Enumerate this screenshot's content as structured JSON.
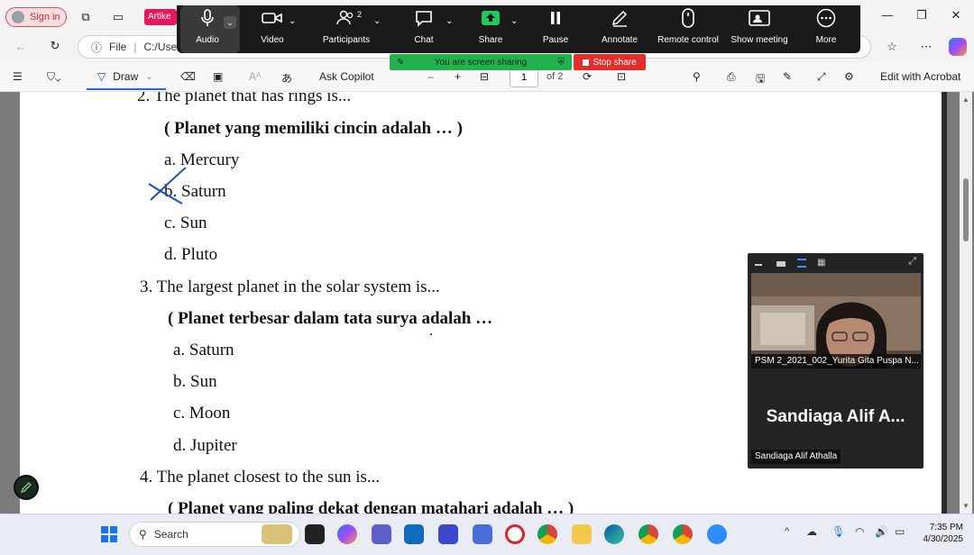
{
  "browser": {
    "sign_in": "Sign in",
    "tab_label": "Artike",
    "address_info": "File",
    "address_path": "C:/Use"
  },
  "zoom": {
    "participant_count": "2",
    "items": [
      {
        "label": "Audio",
        "icon": "microphone-icon"
      },
      {
        "label": "Video",
        "icon": "video-camera-icon"
      },
      {
        "label": "Participants",
        "icon": "participants-icon"
      },
      {
        "label": "Chat",
        "icon": "chat-icon"
      },
      {
        "label": "Share",
        "icon": "share-screen-icon"
      },
      {
        "label": "Pause",
        "icon": "pause-icon"
      },
      {
        "label": "Annotate",
        "icon": "pen-icon"
      },
      {
        "label": "Remote control",
        "icon": "mouse-icon"
      },
      {
        "label": "Show meeting",
        "icon": "meeting-window-icon"
      },
      {
        "label": "More",
        "icon": "more-icon"
      }
    ],
    "sharing_banner": "You are screen sharing",
    "stop_share": "Stop share"
  },
  "pdf_toolbar": {
    "draw": "Draw",
    "ask_copilot": "Ask Copilot",
    "page_current": "1",
    "page_total": "of 2",
    "zoom_minus": "–",
    "zoom_plus": "+",
    "edit_acrobat": "Edit with Acrobat"
  },
  "document": {
    "lines": [
      {
        "text": "2.   The planet that has rings is...",
        "bold": false
      },
      {
        "text": "( Planet yang memiliki cincin adalah … )",
        "bold": true
      },
      {
        "text": "a.   Mercury",
        "bold": false
      },
      {
        "text": "b.   Saturn",
        "bold": false
      },
      {
        "text": "c.   Sun",
        "bold": false
      },
      {
        "text": "d.   Pluto",
        "bold": false
      },
      {
        "text": "3.   The largest planet in the solar system is...",
        "bold": false
      },
      {
        "text": "( Planet terbesar dalam tata surya adalah …",
        "bold": true
      },
      {
        "text": "a.   Saturn",
        "bold": false
      },
      {
        "text": "b.   Sun",
        "bold": false
      },
      {
        "text": "c.   Moon",
        "bold": false
      },
      {
        "text": "d.   Jupiter",
        "bold": false
      },
      {
        "text": "4.   The planet closest to the sun is...",
        "bold": false
      },
      {
        "text": "( Planet yang paling dekat dengan matahari adalah … )",
        "bold": true
      }
    ]
  },
  "video": {
    "participant1_label": "PSM 2_2021_002_Yurita Gita Puspa N...",
    "participant2_display": "Sandiaga Alif A...",
    "participant2_label": "Sandiaga Alif Athalla"
  },
  "taskbar": {
    "search": "Search",
    "time": "7:35 PM",
    "date": "4/30/2025"
  },
  "colors": {
    "zoom_bar": "#1a1a1a",
    "sharing_green": "#22b14c",
    "stop_red": "#e22d2d",
    "annotation_blue": "#1f4fb3"
  }
}
